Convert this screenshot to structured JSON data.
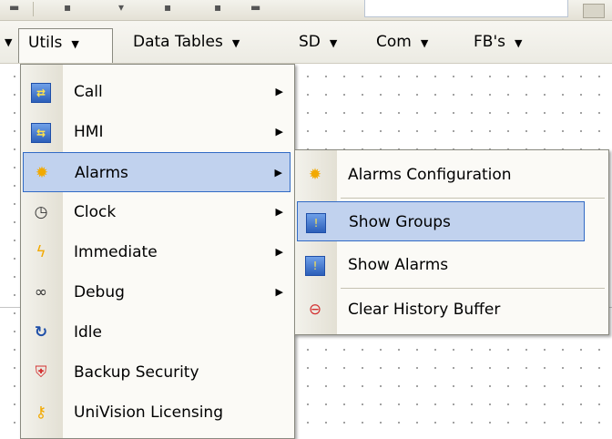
{
  "menubar": {
    "items": [
      {
        "label": "Utils"
      },
      {
        "label": "Data Tables"
      },
      {
        "label": "SD"
      },
      {
        "label": "Com"
      },
      {
        "label": "FB's"
      }
    ],
    "arrow": "▼"
  },
  "utils_menu": {
    "items": [
      {
        "label": "Call",
        "icon": "call-icon",
        "submenu": true
      },
      {
        "label": "HMI",
        "icon": "hmi-icon",
        "submenu": true
      },
      {
        "label": "Alarms",
        "icon": "alarm-bulb-icon",
        "submenu": true,
        "highlighted": true
      },
      {
        "label": "Clock",
        "icon": "clock-icon",
        "submenu": true
      },
      {
        "label": "Immediate",
        "icon": "lightning-icon",
        "submenu": true
      },
      {
        "label": "Debug",
        "icon": "glasses-icon",
        "submenu": true
      },
      {
        "label": "Idle",
        "icon": "idle-icon",
        "submenu": false
      },
      {
        "label": "Backup Security",
        "icon": "shield-icon",
        "submenu": false
      },
      {
        "label": "UniVision Licensing",
        "icon": "key-icon",
        "submenu": false
      }
    ]
  },
  "alarms_submenu": {
    "items": [
      {
        "label": "Alarms Configuration",
        "icon": "alarm-bulb-icon"
      },
      {
        "label": "Show Groups",
        "icon": "show-groups-icon",
        "highlighted": true
      },
      {
        "label": "Show Alarms",
        "icon": "show-alarms-icon"
      },
      {
        "label": "Clear History Buffer",
        "icon": "clear-history-icon"
      }
    ]
  },
  "colors": {
    "highlight_bg": "#c1d2ee",
    "highlight_border": "#316ac5",
    "menu_bg": "#fbfaf6"
  }
}
